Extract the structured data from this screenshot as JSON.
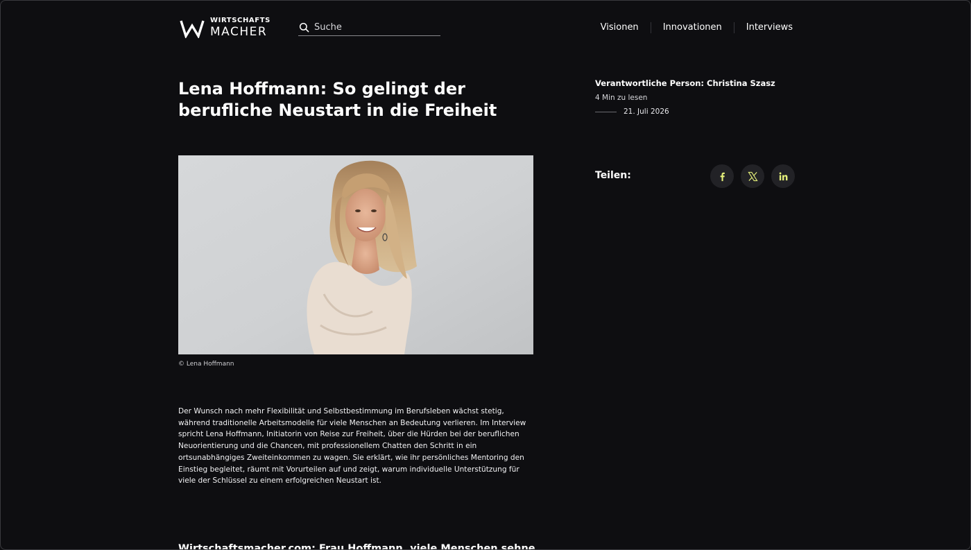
{
  "header": {
    "logo": {
      "top": "WIRTSCHAFTS",
      "bottom": "MACHER"
    },
    "search": {
      "placeholder": "Suche"
    },
    "nav": [
      {
        "label": "Visionen"
      },
      {
        "label": "Innovationen"
      },
      {
        "label": "Interviews"
      }
    ]
  },
  "article": {
    "title": "Lena Hoffmann: So gelingt der berufliche Neustart in die Freiheit",
    "image_caption": "© Lena Hoffmann",
    "intro": "Der Wunsch nach mehr Flexibilität und Selbstbestimmung im Berufsleben wächst stetig, während traditionelle Arbeitsmodelle für viele Menschen an Bedeutung verlieren. Im Interview spricht Lena Hoffmann, Initiatorin von Reise zur Freiheit, über die Hürden bei der beruflichen Neuorientierung und die Chancen, mit professionellem Chatten den Schritt in ein ortsunabhängiges Zweiteinkommen zu wagen. Sie erklärt, wie ihr persönliches Mentoring den Einstieg begleitet, räumt mit Vorurteilen auf und zeigt, warum individuelle Unterstützung für viele der Schlüssel zu einem erfolgreichen Neustart ist.",
    "next_heading": "Wirtschaftsmacher.com: Frau Hoffmann, viele Menschen sehnen sich"
  },
  "sidebar": {
    "author": "Verantwortliche Person: Christina Szasz",
    "read_time": "4 Min zu lesen",
    "date": "21. Juli 2026",
    "share_label": "Teilen:",
    "share_buttons": [
      {
        "icon": "facebook-icon"
      },
      {
        "icon": "x-icon"
      },
      {
        "icon": "linkedin-icon"
      }
    ]
  },
  "colors": {
    "background": "#0e0e11",
    "share_icon": "#e4ef7a",
    "share_button_bg": "#222226"
  }
}
